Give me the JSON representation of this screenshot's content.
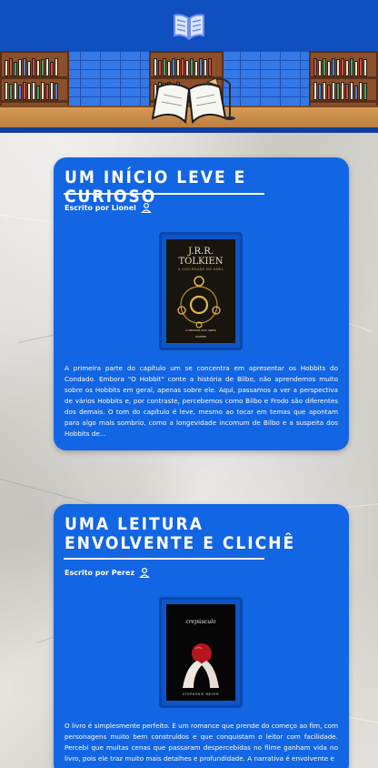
{
  "header": {
    "logo_icon": "open-book-icon",
    "banner_scene": "library-reading-desk"
  },
  "posts": [
    {
      "title": "Um início leve e curioso",
      "author": "Escrito por Lionel",
      "author_icon": "user-icon",
      "cover": {
        "author": "J.R.R. TOLKIEN",
        "subtitle": "A SOCIEDADE DO ANEL",
        "footer": "O SENHOR DOS ANÉIS",
        "publisher": "HARPER"
      },
      "description": "A primeira parte do capítulo um se concentra em apresentar os Hobbits do Condado. Embora \"O Hobbit\" conte a história de Bilbo, não aprendemos muito sobre os Hobbits em geral, apenas sobre ele. Aqui, passamos a ver a perspectiva de vários Hobbits e, por contraste, percebemos como Bilbo e Frodo são diferentes dos demais. O tom do capítulo é leve, mesmo ao tocar em temas que apontam para algo mais sombrio, como a longevidade incomum de Bilbo e a suspeita dos Hobbits de..."
    },
    {
      "title": "Uma leitura envolvente e clichê",
      "author": "Escrito por Perez",
      "author_icon": "user-icon",
      "cover": {
        "title": "crepúsculo",
        "author": "STEPHENIE MEYER"
      },
      "description": "O livro é simplesmente perfeito. É um romance que prende do começo ao fim, com personagens muito bem construídos e que conquistam o leitor com facilidade. Percebi que muitas cenas que passaram despercebidas no filme ganham vida no livro, pois ele traz muito mais detalhes e profundidade. A narrativa é envolvente e"
    }
  ],
  "colors": {
    "topbar": "#0f4fbf",
    "card": "#1265e3",
    "text": "#ffffff"
  }
}
